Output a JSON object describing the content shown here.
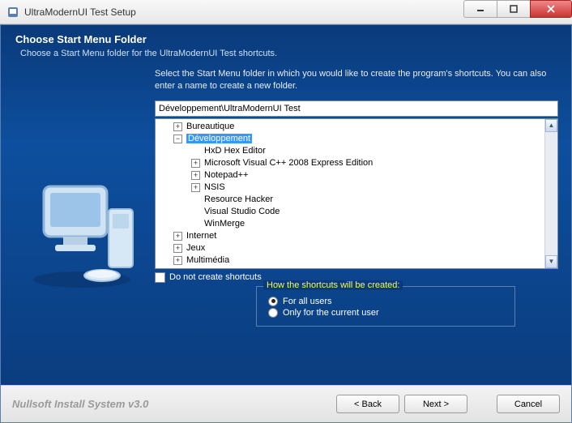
{
  "window": {
    "title": "UltraModernUI Test Setup"
  },
  "header": {
    "title": "Choose Start Menu Folder",
    "subtitle": "Choose a Start Menu folder for the UltraModernUI Test shortcuts."
  },
  "instruct": "Select the Start Menu folder in which you would like to create the program's shortcuts. You can also enter a name to create a new folder.",
  "path": "Développement\\UltraModernUI Test",
  "tree": [
    {
      "label": "Bureautique",
      "level": 1,
      "toggle": "+"
    },
    {
      "label": "Développement",
      "level": 1,
      "toggle": "−",
      "selected": true
    },
    {
      "label": "HxD Hex Editor",
      "level": 2,
      "toggle": ""
    },
    {
      "label": "Microsoft Visual C++ 2008 Express Edition",
      "level": 2,
      "toggle": "+"
    },
    {
      "label": "Notepad++",
      "level": 2,
      "toggle": "+"
    },
    {
      "label": "NSIS",
      "level": 2,
      "toggle": "+"
    },
    {
      "label": "Resource Hacker",
      "level": 2,
      "toggle": ""
    },
    {
      "label": "Visual Studio Code",
      "level": 2,
      "toggle": ""
    },
    {
      "label": "WinMerge",
      "level": 2,
      "toggle": ""
    },
    {
      "label": "Internet",
      "level": 1,
      "toggle": "+"
    },
    {
      "label": "Jeux",
      "level": 1,
      "toggle": "+"
    },
    {
      "label": "Multimédia",
      "level": 1,
      "toggle": "+"
    }
  ],
  "checkbox": {
    "label": "Do not create shortcuts"
  },
  "group": {
    "legend": "How the shortcuts will be created:",
    "opt1": "For all users",
    "opt2": "Only for the current user"
  },
  "footer": {
    "brand": "Nullsoft Install System v3.0",
    "back": "< Back",
    "next": "Next >",
    "cancel": "Cancel"
  }
}
